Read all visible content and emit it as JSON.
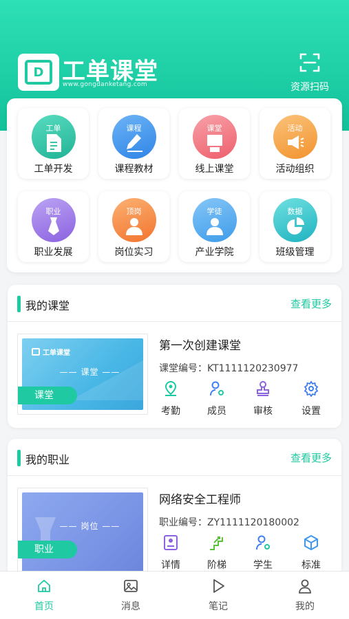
{
  "header": {
    "brand": "工单课堂",
    "brand_url": "www.gongdanketang.com",
    "scan_label": "资源扫码"
  },
  "features": [
    {
      "label": "工单开发",
      "tag": "工单",
      "color": "#35c4a6"
    },
    {
      "label": "课程教材",
      "tag": "课程",
      "color": "#3e97f0"
    },
    {
      "label": "线上课堂",
      "tag": "课堂",
      "color": "#f26f7b"
    },
    {
      "label": "活动组织",
      "tag": "活动",
      "color": "#f5a13d"
    },
    {
      "label": "职业发展",
      "tag": "职业",
      "color": "#9b72e8"
    },
    {
      "label": "岗位实习",
      "tag": "顶岗",
      "color": "#f78a3e"
    },
    {
      "label": "产业学院",
      "tag": "学徒",
      "color": "#4aa7ee"
    },
    {
      "label": "班级管理",
      "tag": "数据",
      "color": "#27c0c8"
    }
  ],
  "classroom": {
    "title": "我的课堂",
    "more": "查看更多",
    "thumb_brand": "工单课堂",
    "thumb_caption": "—— 课堂 ——",
    "thumb_pill": "课堂",
    "name": "第一次创建课堂",
    "code": "课堂编号：KT1111120230977",
    "actions": [
      "考勤",
      "成员",
      "审核",
      "设置"
    ]
  },
  "career": {
    "title": "我的职业",
    "more": "查看更多",
    "thumb_caption": "—— 岗位 ——",
    "thumb_pill": "职业",
    "name": "网络安全工程师",
    "code": "职业编号：ZY1111120180002",
    "actions": [
      "详情",
      "阶梯",
      "学生",
      "标准"
    ]
  },
  "tabs": [
    {
      "label": "首页",
      "icon": "home-icon",
      "active": true
    },
    {
      "label": "消息",
      "icon": "image-icon",
      "active": false
    },
    {
      "label": "笔记",
      "icon": "play-icon",
      "active": false
    },
    {
      "label": "我的",
      "icon": "user-icon",
      "active": false
    }
  ],
  "colors": {
    "accent": "#1fc9a2"
  }
}
